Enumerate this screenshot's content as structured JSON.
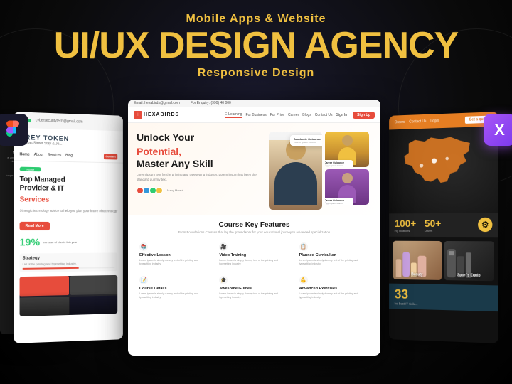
{
  "header": {
    "subtitle_top": "Mobile Apps & Website",
    "main_title": "UI/UX DESIGN AGENCY",
    "subtitle_bottom": "Responsive Design"
  },
  "screens": {
    "left": {
      "logo": "GREY TOKEN",
      "tagline": "cybersecuritytechnologies@gmail.com",
      "badge": "Home",
      "title": "Top Managed",
      "title2": "Provider & IT",
      "services": "Services",
      "description": "Strategic technology advice to help you plan your future of technology",
      "btn_label": "Read More",
      "stat_number": "19%",
      "stat_label": "Increase of clients this year",
      "strategy_title": "Strategy",
      "strategy_text": "List of the printing and typesetting industry."
    },
    "center": {
      "email_bar": "Email: hexabirds@gmail.com",
      "enquiry_bar": "For Enquiry: (990) 40 000",
      "logo_text": "HEXABIRDS",
      "nav_elearning": "E-Learning",
      "nav_for_business": "For Business",
      "nav_for_price": "For Price",
      "nav_career": "Career",
      "nav_blogs": "Blogs",
      "nav_contact": "Contact Us",
      "nav_signin": "Sign In",
      "nav_signup": "Sign Up",
      "hero_title": "Unlock Your",
      "hero_title_red": "Potential,",
      "hero_title3": "Master Any Skill",
      "hero_description": "Lorem ipsum text for the printing and typesetting industry. Lorem ipsum has been the standard dummy text.",
      "features_title": "Course Key Features",
      "features_sub": "From Foundations Courses that lay the groundwork for your educational journey to advanced specialization",
      "feature1_icon": "📚",
      "feature1_title": "Effective Lesson",
      "feature1_text": "Lorem ipsum is simply dummy text of the printing and typesetting industry.",
      "feature2_icon": "🎥",
      "feature2_title": "Video Training",
      "feature2_text": "Lorem ipsum is simply dummy text of the printing and typesetting industry.",
      "feature3_icon": "📋",
      "feature3_title": "Planned Curriculum",
      "feature3_text": "Lorem ipsum is simply dummy text of the printing and typesetting industry.",
      "feature4_icon": "📝",
      "feature4_title": "Course Details",
      "feature4_text": "Lorem ipsum is simply dummy text of the printing and typesetting industry.",
      "feature5_icon": "🎓",
      "feature5_title": "Awesome Guides",
      "feature5_text": "Lorem ipsum is simply dummy text of the printing and typesetting industry.",
      "feature6_icon": "💪",
      "feature6_title": "Advanced Exercises",
      "feature6_text": "Lorem ipsum is simply dummy text of the printing and typesetting industry.",
      "badge1_title": "Academic Guidance",
      "badge1_text": "Lorem ipsum dolor",
      "badge2_title": "Career Guidance",
      "badge2_text": "Lorem ipsum dolor",
      "badge3_title": "Career Guidance",
      "badge3_text": "Lorem ipsum dolor"
    },
    "right": {
      "nav_orders": "Orders",
      "nav_contact": "Contact Us",
      "nav_login": "Login",
      "nav_btn": "Get a quote",
      "stat1_number": "100+",
      "stat1_label": "ing locations",
      "stat2_number": "50+",
      "stat2_label": "Drives",
      "product1_label": "Beauty",
      "product2_label": "Sport's Equip",
      "bottom_number": "33",
      "bottom_text": "he best IT Solu..."
    }
  }
}
